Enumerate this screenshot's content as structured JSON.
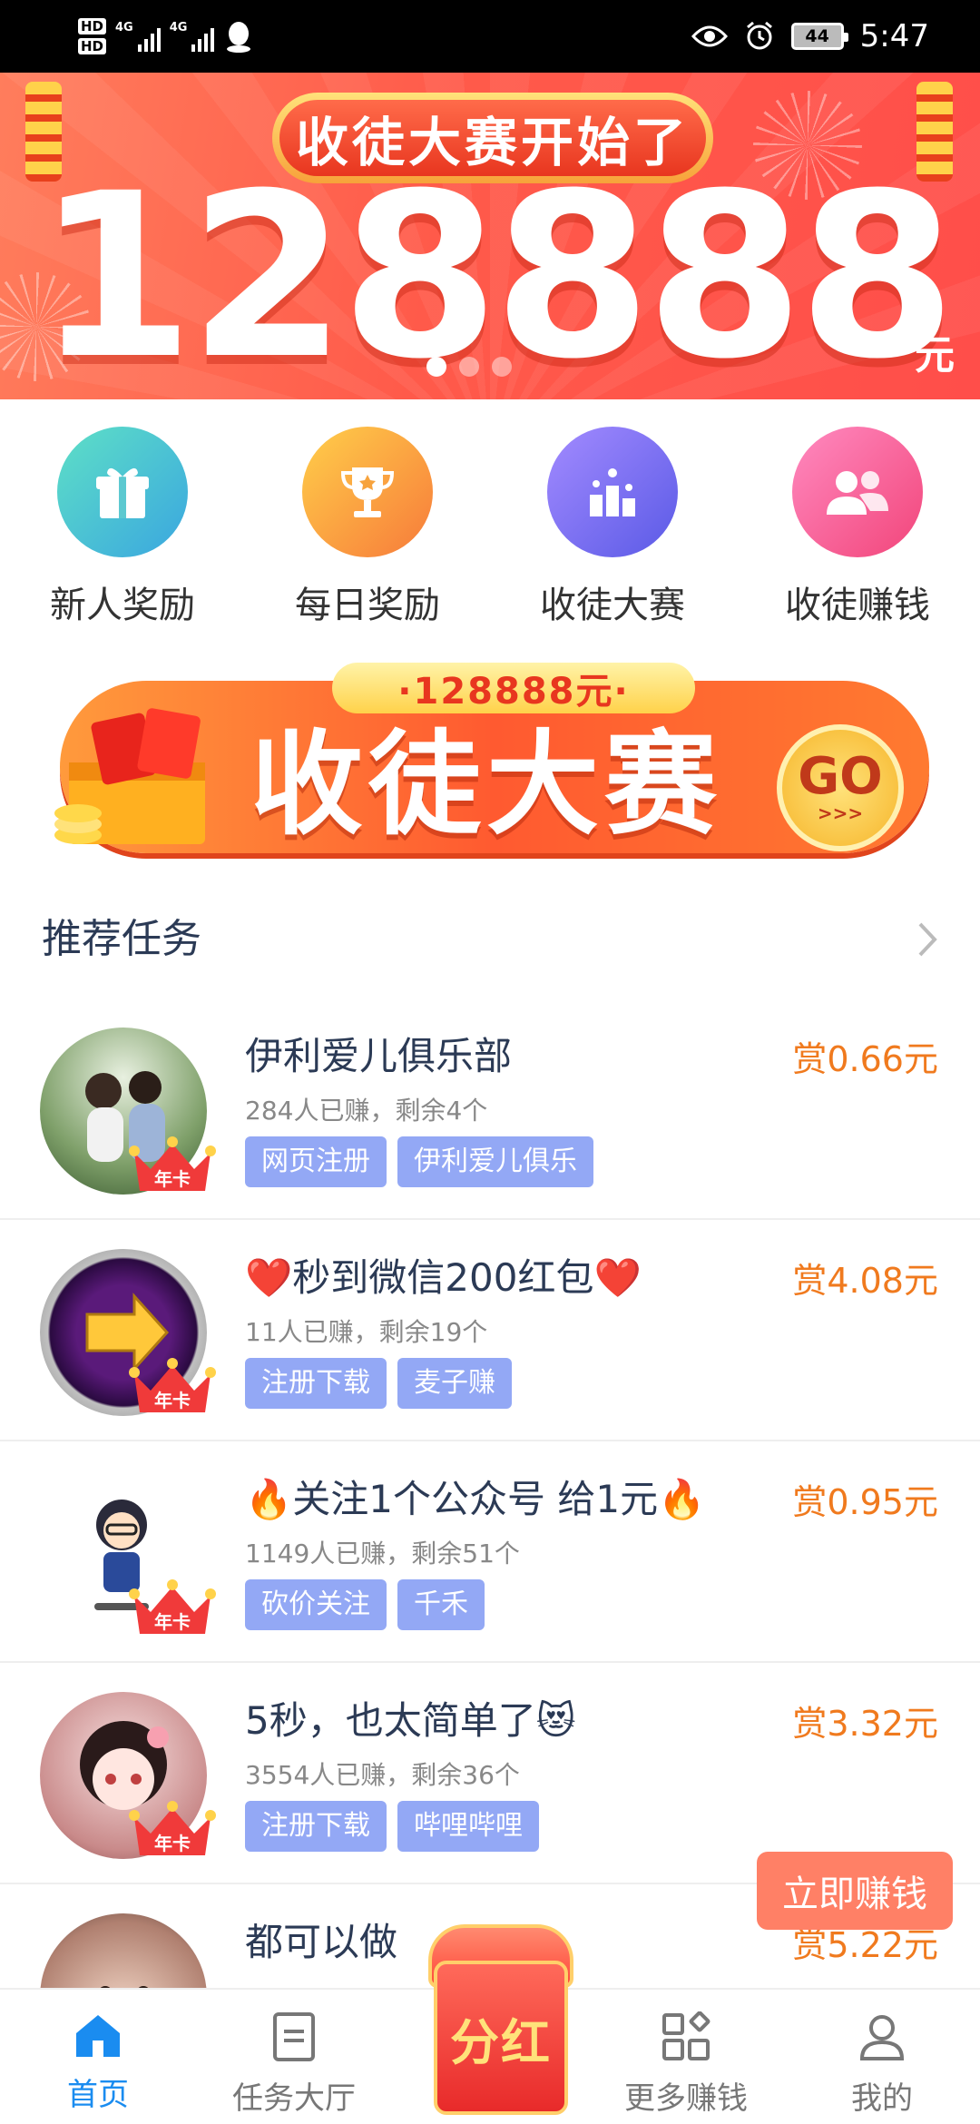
{
  "status_bar": {
    "time": "5:47",
    "battery": "44",
    "network_1": "4G",
    "network_2": "4G",
    "hd_1": "HD",
    "hd_2": "HD"
  },
  "banner": {
    "title": "收徒大赛开始了",
    "amount": "128888",
    "unit": "元",
    "active_slide": 1,
    "slide_count": 3
  },
  "shortcuts": [
    {
      "label": "新人奖励",
      "icon": "gift-icon",
      "color": "#4ec9b8"
    },
    {
      "label": "每日奖励",
      "icon": "trophy-icon",
      "color": "#f7a33d"
    },
    {
      "label": "收徒大赛",
      "icon": "podium-icon",
      "color": "#7b6df0"
    },
    {
      "label": "收徒赚钱",
      "icon": "users-icon",
      "color": "#f76aa0"
    }
  ],
  "promo": {
    "tag": "·128888元·",
    "title": "收徒大赛",
    "go": "GO",
    "go_sub": ">>>"
  },
  "section": {
    "title": "推荐任务"
  },
  "tasks": [
    {
      "title": "伊利爱儿俱乐部",
      "meta": "284人已赚，剩余4个",
      "tags": [
        "网页注册",
        "伊利爱儿俱乐"
      ],
      "reward": "赏0.66元",
      "badge": "年卡"
    },
    {
      "title": "❤️秒到微信200红包❤️",
      "meta": "11人已赚，剩余19个",
      "tags": [
        "注册下载",
        "麦子赚"
      ],
      "reward": "赏4.08元",
      "badge": "年卡"
    },
    {
      "title": "🔥关注1个公众号 给1元🔥",
      "meta": "1149人已赚，剩余51个",
      "tags": [
        "砍价关注",
        "千禾"
      ],
      "reward": "赏0.95元",
      "badge": "年卡"
    },
    {
      "title": "5秒，也太简单了😻",
      "meta": "3554人已赚，剩余36个",
      "tags": [
        "注册下载",
        "哔哩哔哩"
      ],
      "reward": "赏3.32元",
      "badge": "年卡"
    },
    {
      "title": "都可以做",
      "reward": "赏5.22元"
    }
  ],
  "float_button": "立即赚钱",
  "nav": [
    {
      "label": "首页",
      "icon": "home-icon",
      "active": true
    },
    {
      "label": "任务大厅",
      "icon": "document-icon",
      "active": false
    },
    {
      "label": "分红",
      "icon": "red-envelope-icon",
      "active": false
    },
    {
      "label": "更多赚钱",
      "icon": "apps-icon",
      "active": false
    },
    {
      "label": "我的",
      "icon": "profile-icon",
      "active": false
    }
  ],
  "colors": {
    "accent_blue": "#1a8cf0",
    "reward_orange": "#f07a1e",
    "tag_blue": "#93a8f5",
    "banner_red": "#ff5a4a"
  }
}
